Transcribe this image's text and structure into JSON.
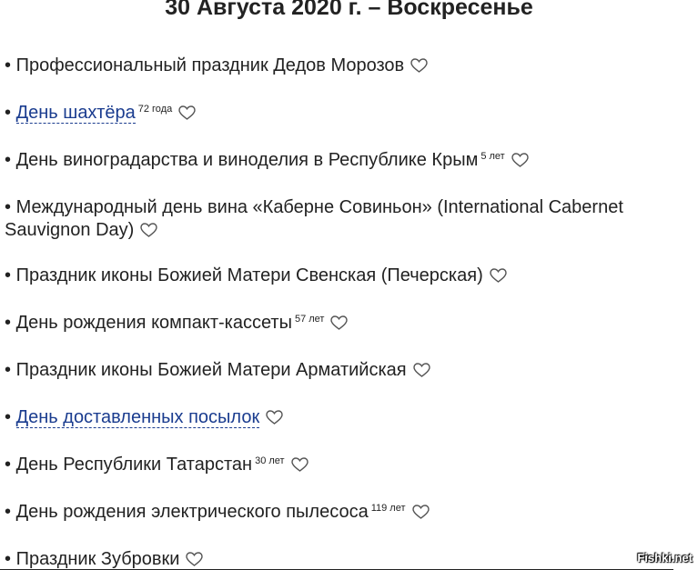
{
  "header": {
    "title": "30 Августа 2020 г. – Воскресенье"
  },
  "bullet": "•",
  "holidays": [
    {
      "name": "Профессиональный праздник Дедов Морозов"
    },
    {
      "name": "День шахтёра",
      "years": "72 года",
      "is_link": true
    },
    {
      "name": "День виноградарства и виноделия в Республике Крым",
      "years": "5 лет"
    },
    {
      "name": "Международный день вина «Каберне Совиньон» (International Cabernet Sauvignon Day)"
    },
    {
      "name": "Праздник иконы Божией Матери Свенская (Печерская)"
    },
    {
      "name": "День рождения компакт-кассеты",
      "years": "57 лет"
    },
    {
      "name": "Праздник иконы Божией Матери Арматийская"
    },
    {
      "name": "День доставленных посылок",
      "is_link": true
    },
    {
      "name": "День Республики Татарстан",
      "years": "30 лет"
    },
    {
      "name": "День рождения электрического пылесоса",
      "years": "119 лет"
    },
    {
      "name": "Праздник Зубровки"
    }
  ],
  "watermark": "Fishki.net",
  "colors": {
    "text": "#222222",
    "link": "#1a3c8f",
    "heart_outline": "#555555"
  }
}
